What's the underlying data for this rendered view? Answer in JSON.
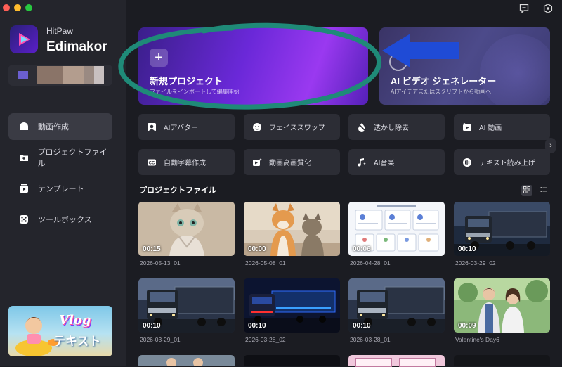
{
  "app": {
    "brand_small": "HitPaw",
    "brand_big": "Edimakor"
  },
  "sidebar": {
    "items": [
      {
        "label": "動画作成",
        "icon": "home-icon",
        "active": true
      },
      {
        "label": "プロジェクトファイル",
        "icon": "folder-icon",
        "active": false
      },
      {
        "label": "テンプレート",
        "icon": "template-icon",
        "active": false
      },
      {
        "label": "ツールボックス",
        "icon": "toolbox-icon",
        "active": false
      }
    ],
    "promo": {
      "title": "Vlog",
      "subtitle": "テキスト"
    }
  },
  "header_icons": [
    "feedback-icon",
    "settings-icon"
  ],
  "hero": {
    "new_project": {
      "title": "新規プロジェクト",
      "subtitle": "ファイルをインポートして編集開始"
    },
    "ai_generator": {
      "title": "AI ビデオ ジェネレーター",
      "subtitle": "AIアイデアまたはスクリプトから動画へ"
    }
  },
  "tools": [
    {
      "label": "AIアバター",
      "icon": "avatar-icon"
    },
    {
      "label": "フェイススワップ",
      "icon": "face-swap-icon"
    },
    {
      "label": "透かし除去",
      "icon": "watermark-remove-icon"
    },
    {
      "label": "AI 動画",
      "icon": "ai-video-icon"
    },
    {
      "label": "自動字幕作成",
      "icon": "caption-icon"
    },
    {
      "label": "動画高画質化",
      "icon": "enhance-icon"
    },
    {
      "label": "AI音楽",
      "icon": "music-icon"
    },
    {
      "label": "テキスト読み上げ",
      "icon": "tts-icon"
    }
  ],
  "projects": {
    "title": "プロジェクトファイル",
    "items": [
      {
        "name": "2026-05-13_01",
        "duration": "00:15",
        "thumb": "cat"
      },
      {
        "name": "2026-05-08_01",
        "duration": "00:00",
        "thumb": "dog-cat"
      },
      {
        "name": "2026-04-28_01",
        "duration": "00:06",
        "thumb": "document"
      },
      {
        "name": "2026-03-29_02",
        "duration": "00:10",
        "thumb": "truck"
      },
      {
        "name": "2026-03-29_01",
        "duration": "00:10",
        "thumb": "truck"
      },
      {
        "name": "2026-03-28_02",
        "duration": "00:10",
        "thumb": "truck-blue"
      },
      {
        "name": "2026-03-28_01",
        "duration": "00:10",
        "thumb": "truck"
      },
      {
        "name": "Valentine's Day6",
        "duration": "00:09",
        "thumb": "couple"
      }
    ]
  },
  "colors": {
    "accent": "#7b2ff0",
    "annotation_ellipse": "#1f8a78",
    "annotation_arrow": "#1f4bd6"
  }
}
